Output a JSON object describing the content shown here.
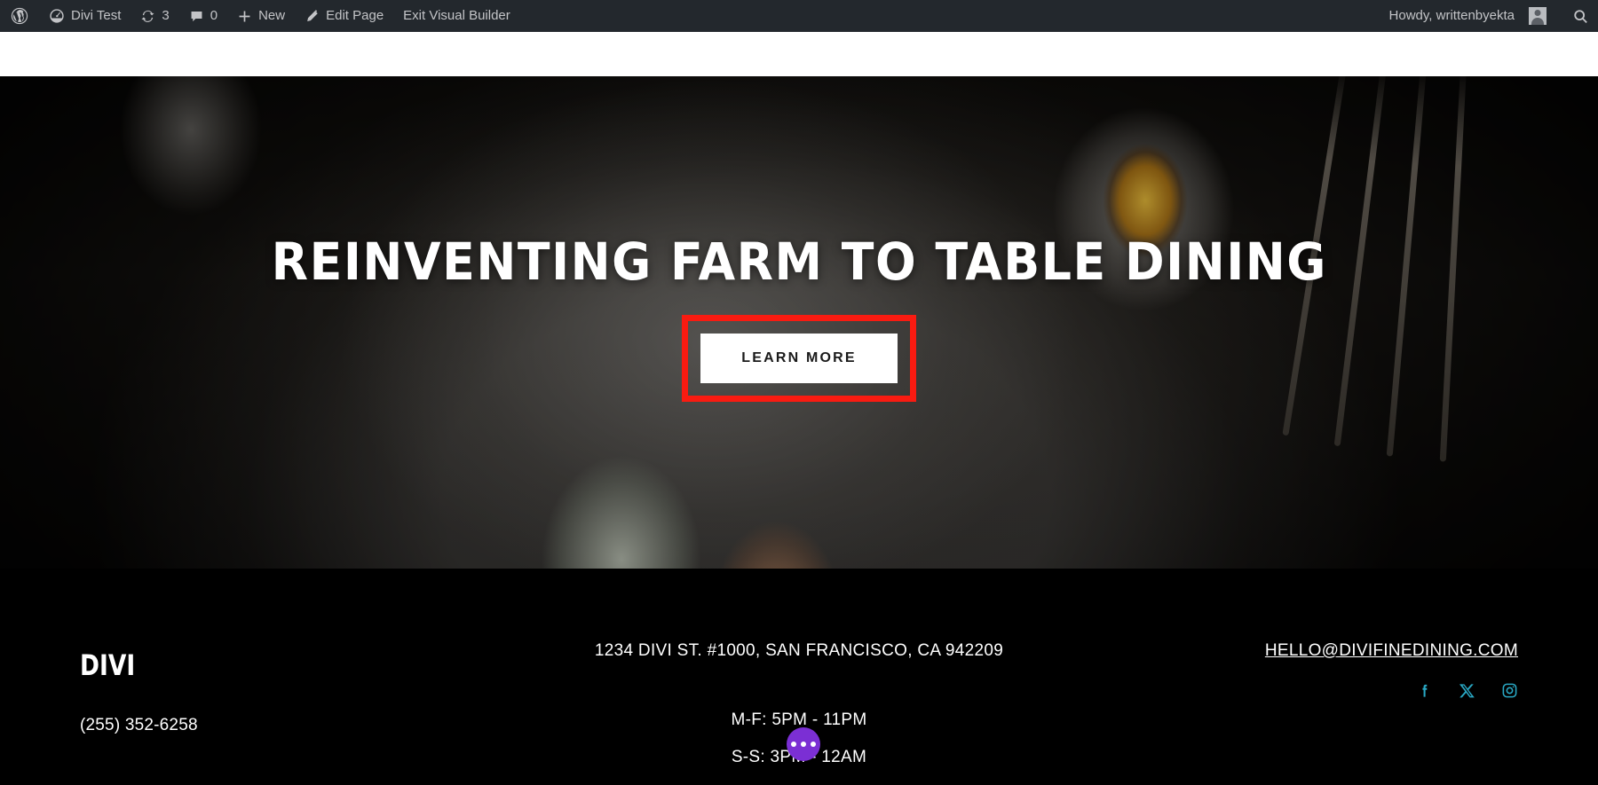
{
  "adminbar": {
    "wp_logo_icon": "wordpress-logo-icon",
    "site_icon": "dashboard-icon",
    "site_name": "Divi Test",
    "revisions_icon": "revisions-icon",
    "revisions_count": "3",
    "comments_icon": "comment-bubble-icon",
    "comments_count": "0",
    "new_icon": "plus-icon",
    "new_label": "New",
    "edit_icon": "pencil-icon",
    "edit_label": "Edit Page",
    "exit_label": "Exit Visual Builder",
    "howdy": "Howdy, writtenbyekta",
    "avatar_icon": "user-avatar-icon",
    "search_icon": "search-icon",
    "bg_color": "#23282d",
    "text_color": "#c3c4c7"
  },
  "hero": {
    "title": "Reinventing Farm To Table Dining",
    "cta_label": "Learn More",
    "highlight_color": "#f91b11",
    "cta_bg": "#ffffff",
    "cta_text_color": "#1a1a1a"
  },
  "footer": {
    "logo": "DIVI",
    "phone": "(255) 352-6258",
    "address": "1234 DIVI ST. #1000, SAN FRANCISCO, CA 942209",
    "hours": [
      "M-F: 5PM - 11PM",
      "S-S: 3PM - 12AM"
    ],
    "email": "HELLO@DIVIFINEDINING.COM",
    "social": [
      {
        "name": "facebook-icon",
        "glyph": "f"
      },
      {
        "name": "x-twitter-icon",
        "glyph": "X"
      },
      {
        "name": "instagram-icon",
        "glyph": "IG"
      }
    ],
    "social_color": "#29a8c4",
    "bg_color": "#000000"
  },
  "overlay": {
    "divi_bubble_icon": "divi-settings-dots-icon",
    "divi_bubble_color": "#7b2fd4"
  }
}
